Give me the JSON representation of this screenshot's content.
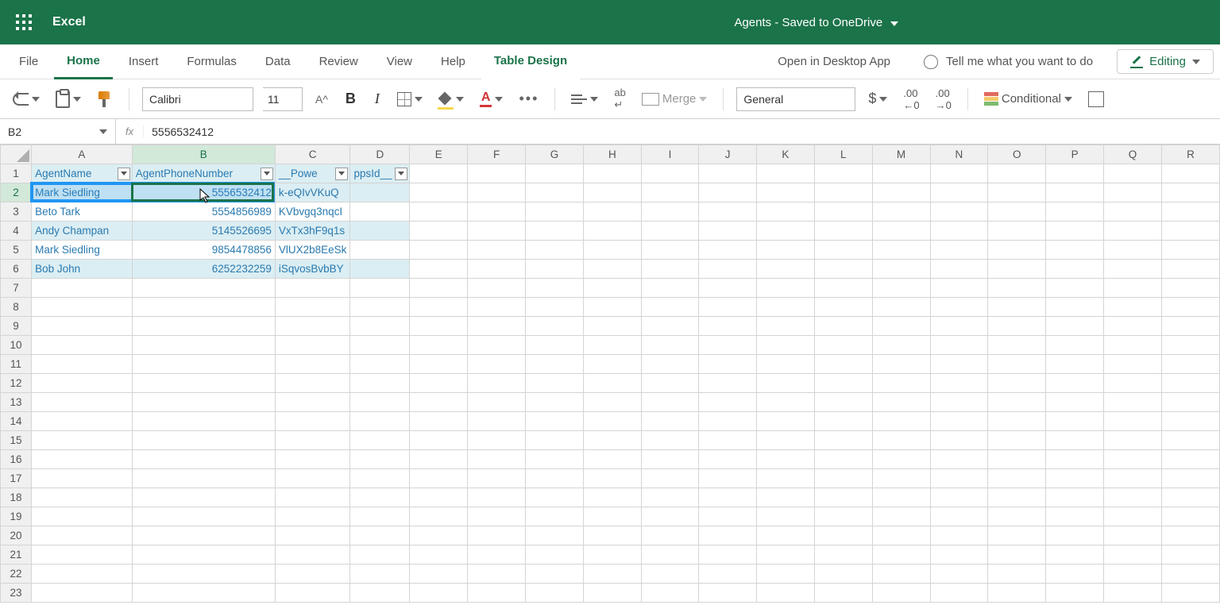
{
  "titlebar": {
    "app_name": "Excel",
    "doc_name": "Agents",
    "save_state": " - Saved to OneDrive"
  },
  "ribbon": {
    "tabs": [
      "File",
      "Home",
      "Insert",
      "Formulas",
      "Data",
      "Review",
      "View",
      "Help",
      "Table Design"
    ],
    "open_desktop": "Open in Desktop App",
    "tell_me": "Tell me what you want to do",
    "editing": "Editing"
  },
  "toolbar": {
    "font_name": "Calibri",
    "font_size": "11",
    "font_grow": "A^",
    "merge_label": "Merge",
    "number_format": "General",
    "conditional": "Conditional"
  },
  "formula_bar": {
    "name_box": "B2",
    "fx": "fx",
    "value": "5556532412"
  },
  "grid": {
    "columns": [
      "A",
      "B",
      "C",
      "D",
      "E",
      "F",
      "G",
      "H",
      "I",
      "J",
      "K",
      "L",
      "M",
      "N",
      "O",
      "P",
      "Q",
      "R"
    ],
    "rows": [
      1,
      2,
      3,
      4,
      5,
      6,
      7,
      8,
      9,
      10,
      11,
      12,
      13,
      14,
      15,
      16,
      17,
      18,
      19,
      20,
      21,
      22,
      23
    ],
    "headers": {
      "A": "AgentName",
      "B": "AgentPhoneNumber",
      "C": "__Powe",
      "D": "ppsId__"
    },
    "data": [
      {
        "A": "Mark Siedling",
        "B": "5556532412",
        "C": "k-eQIvVKuQ"
      },
      {
        "A": "Beto Tark",
        "B": "5554856989",
        "C": "KVbvgq3nqcI"
      },
      {
        "A": "Andy Champan",
        "B": "5145526695",
        "C": "VxTx3hF9q1s"
      },
      {
        "A": "Mark Siedling",
        "B": "9854478856",
        "C": "VlUX2b8EeSk"
      },
      {
        "A": "Bob John",
        "B": "6252232259",
        "C": "iSqvosBvbBY"
      }
    ]
  }
}
